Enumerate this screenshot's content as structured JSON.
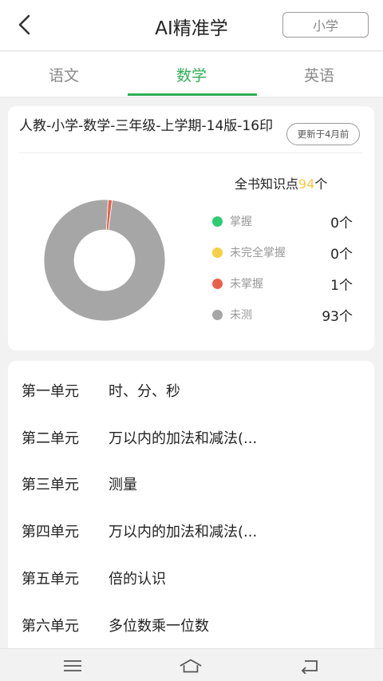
{
  "header": {
    "title": "AI精准学",
    "grade_button": "小学",
    "back_icon": "chevron-left-icon"
  },
  "tabs": [
    {
      "label": "语文",
      "active": false
    },
    {
      "label": "数学",
      "active": true
    },
    {
      "label": "英语",
      "active": false
    }
  ],
  "summary": {
    "book_title": "人教-小学-数学-三年级-上学期-14版-16印",
    "update_tag": "更新于4月前",
    "total_prefix": "全书知识点",
    "total_count": "94",
    "total_suffix": "个",
    "legend": [
      {
        "label": "掌握",
        "count": "0个",
        "value": 0,
        "color": "#2ecc71"
      },
      {
        "label": "未完全掌握",
        "count": "0个",
        "value": 0,
        "color": "#f5cf45"
      },
      {
        "label": "未掌握",
        "count": "1个",
        "value": 1,
        "color": "#e8604c"
      },
      {
        "label": "未测",
        "count": "93个",
        "value": 93,
        "color": "#a6a6a6"
      }
    ]
  },
  "units": [
    {
      "num": "第一单元",
      "name": "时、分、秒"
    },
    {
      "num": "第二单元",
      "name": "万以内的加法和减法(..."
    },
    {
      "num": "第三单元",
      "name": "测量"
    },
    {
      "num": "第四单元",
      "name": "万以内的加法和减法(..."
    },
    {
      "num": "第五单元",
      "name": "倍的认识"
    },
    {
      "num": "第六单元",
      "name": "多位数乘一位数"
    }
  ],
  "navbar": {
    "menu_icon": "menu-icon",
    "home_icon": "home-icon",
    "back_icon": "return-icon"
  }
}
